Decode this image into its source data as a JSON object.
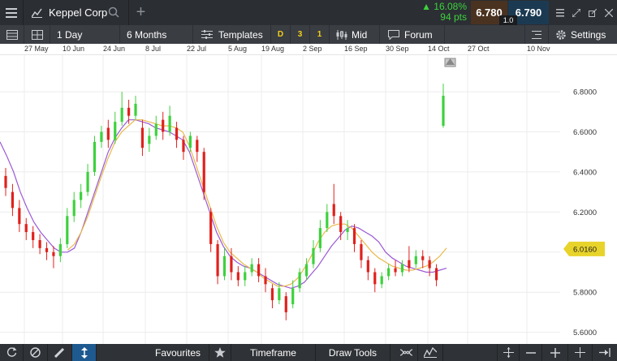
{
  "app": {
    "instrument_name": "Keppel Corp",
    "add_tab_symbol": "+",
    "price_change_pct": "16.08%",
    "price_change_pts": "94 pts",
    "sell_price": "6.780",
    "buy_price": "6.790",
    "spread": "1.0",
    "up_color": "#3dd13d",
    "down_color": "#e0211d"
  },
  "toolbar": {
    "interval": "1 Day",
    "range": "6 Months",
    "templates_label": "Templates",
    "badge_d": "D",
    "badge_3": "3",
    "badge_1": "1",
    "price_type": "Mid",
    "forum_label": "Forum",
    "settings_label": "Settings"
  },
  "bottom": {
    "favourites_label": "Favourites",
    "timeframe_label": "Timeframe",
    "draw_tools_label": "Draw Tools"
  },
  "chart_data": {
    "type": "candlestick",
    "x_tick_labels": [
      "27 May",
      "10 Jun",
      "24 Jun",
      "8 Jul",
      "22 Jul",
      "5 Aug",
      "19 Aug",
      "2 Sep",
      "16 Sep",
      "30 Sep",
      "14 Oct",
      "27 Oct",
      "10 Nov"
    ],
    "y_tick_labels": [
      "6.8000",
      "6.6000",
      "6.4000",
      "6.2000",
      "6.0000",
      "5.8000",
      "5.6000"
    ],
    "ylim": [
      5.55,
      6.95
    ],
    "current_price_label": "6.0160",
    "current_price_color": "#e8d32a",
    "grid": true,
    "moving_averages": [
      {
        "color": "#9b59d6",
        "values": [
          6.55,
          6.48,
          6.4,
          6.3,
          6.22,
          6.15,
          6.1,
          6.06,
          6.02,
          6.0,
          6.0,
          6.02,
          6.1,
          6.2,
          6.3,
          6.4,
          6.5,
          6.57,
          6.62,
          6.66,
          6.66,
          6.65,
          6.64,
          6.62,
          6.61,
          6.6,
          6.58,
          6.56,
          6.5,
          6.4,
          6.3,
          6.2,
          6.1,
          6.03,
          5.98,
          5.95,
          5.93,
          5.92,
          5.9,
          5.88,
          5.86,
          5.84,
          5.83,
          5.82,
          5.83,
          5.85,
          5.89,
          5.93,
          5.98,
          6.03,
          6.07,
          6.11,
          6.13,
          6.12,
          6.1,
          6.08,
          6.05,
          6.0,
          5.97,
          5.95,
          5.93,
          5.92,
          5.91,
          5.9,
          5.9,
          5.91,
          5.92
        ]
      },
      {
        "color": "#e8b94a",
        "values": [
          null,
          null,
          null,
          null,
          null,
          null,
          null,
          null,
          null,
          null,
          6.01,
          6.04,
          6.1,
          6.18,
          6.28,
          6.38,
          6.47,
          6.55,
          6.6,
          6.63,
          6.66,
          6.66,
          6.65,
          6.64,
          6.63,
          6.63,
          6.62,
          6.6,
          6.53,
          6.43,
          6.33,
          6.23,
          6.13,
          6.05,
          6.0,
          5.97,
          5.94,
          5.92,
          5.9,
          5.87,
          5.85,
          5.83,
          5.83,
          5.84,
          5.87,
          5.92,
          5.98,
          6.05,
          6.1,
          6.13,
          6.14,
          6.14,
          6.12,
          6.08,
          6.04,
          6.0,
          5.97,
          5.95,
          5.93,
          5.92,
          5.91,
          5.91,
          5.92,
          5.93,
          5.95,
          5.98,
          6.02
        ]
      }
    ],
    "candles": [
      {
        "o": 6.38,
        "c": 6.32,
        "h": 6.42,
        "l": 6.28
      },
      {
        "o": 6.3,
        "c": 6.22,
        "h": 6.34,
        "l": 6.18
      },
      {
        "o": 6.22,
        "c": 6.14,
        "h": 6.26,
        "l": 6.1
      },
      {
        "o": 6.14,
        "c": 6.1,
        "h": 6.17,
        "l": 6.06
      },
      {
        "o": 6.1,
        "c": 6.06,
        "h": 6.13,
        "l": 6.02
      },
      {
        "o": 6.06,
        "c": 6.02,
        "h": 6.09,
        "l": 5.99
      },
      {
        "o": 6.02,
        "c": 6.0,
        "h": 6.05,
        "l": 5.96
      },
      {
        "o": 6.0,
        "c": 5.98,
        "h": 6.03,
        "l": 5.92
      },
      {
        "o": 5.98,
        "c": 6.04,
        "h": 6.07,
        "l": 5.95
      },
      {
        "o": 6.04,
        "c": 6.18,
        "h": 6.22,
        "l": 6.02
      },
      {
        "o": 6.18,
        "c": 6.26,
        "h": 6.3,
        "l": 6.15
      },
      {
        "o": 6.26,
        "c": 6.3,
        "h": 6.34,
        "l": 6.22
      },
      {
        "o": 6.3,
        "c": 6.4,
        "h": 6.44,
        "l": 6.28
      },
      {
        "o": 6.4,
        "c": 6.55,
        "h": 6.58,
        "l": 6.38
      },
      {
        "o": 6.55,
        "c": 6.6,
        "h": 6.63,
        "l": 6.52
      },
      {
        "o": 6.62,
        "c": 6.56,
        "h": 6.66,
        "l": 6.52
      },
      {
        "o": 6.56,
        "c": 6.65,
        "h": 6.7,
        "l": 6.54
      },
      {
        "o": 6.65,
        "c": 6.72,
        "h": 6.8,
        "l": 6.63
      },
      {
        "o": 6.72,
        "c": 6.68,
        "h": 6.76,
        "l": 6.64
      },
      {
        "o": 6.68,
        "c": 6.74,
        "h": 6.78,
        "l": 6.66
      },
      {
        "o": 6.62,
        "c": 6.52,
        "h": 6.66,
        "l": 6.48
      },
      {
        "o": 6.54,
        "c": 6.58,
        "h": 6.62,
        "l": 6.5
      },
      {
        "o": 6.58,
        "c": 6.64,
        "h": 6.68,
        "l": 6.56
      },
      {
        "o": 6.66,
        "c": 6.6,
        "h": 6.7,
        "l": 6.56
      },
      {
        "o": 6.6,
        "c": 6.68,
        "h": 6.73,
        "l": 6.58
      },
      {
        "o": 6.62,
        "c": 6.56,
        "h": 6.65,
        "l": 6.52
      },
      {
        "o": 6.56,
        "c": 6.5,
        "h": 6.58,
        "l": 6.46
      },
      {
        "o": 6.52,
        "c": 6.58,
        "h": 6.6,
        "l": 6.5
      },
      {
        "o": 6.56,
        "c": 6.5,
        "h": 6.58,
        "l": 6.45
      },
      {
        "o": 6.5,
        "c": 6.3,
        "h": 6.52,
        "l": 6.26
      },
      {
        "o": 6.2,
        "c": 6.04,
        "h": 6.22,
        "l": 6.0
      },
      {
        "o": 6.04,
        "c": 5.88,
        "h": 6.06,
        "l": 5.84
      },
      {
        "o": 5.88,
        "c": 5.98,
        "h": 6.02,
        "l": 5.86
      },
      {
        "o": 5.98,
        "c": 5.9,
        "h": 6.02,
        "l": 5.86
      },
      {
        "o": 5.9,
        "c": 5.86,
        "h": 5.93,
        "l": 5.83
      },
      {
        "o": 5.86,
        "c": 5.9,
        "h": 5.93,
        "l": 5.83
      },
      {
        "o": 5.9,
        "c": 5.94,
        "h": 5.97,
        "l": 5.88
      },
      {
        "o": 5.94,
        "c": 5.88,
        "h": 5.97,
        "l": 5.85
      },
      {
        "o": 5.88,
        "c": 5.84,
        "h": 5.92,
        "l": 5.8
      },
      {
        "o": 5.82,
        "c": 5.76,
        "h": 5.84,
        "l": 5.72
      },
      {
        "o": 5.76,
        "c": 5.82,
        "h": 5.85,
        "l": 5.74
      },
      {
        "o": 5.78,
        "c": 5.7,
        "h": 5.8,
        "l": 5.66
      },
      {
        "o": 5.74,
        "c": 5.82,
        "h": 5.86,
        "l": 5.72
      },
      {
        "o": 5.82,
        "c": 5.9,
        "h": 5.92,
        "l": 5.8
      },
      {
        "o": 5.88,
        "c": 5.94,
        "h": 5.97,
        "l": 5.86
      },
      {
        "o": 5.94,
        "c": 6.02,
        "h": 6.06,
        "l": 5.92
      },
      {
        "o": 6.02,
        "c": 6.12,
        "h": 6.16,
        "l": 6.0
      },
      {
        "o": 6.12,
        "c": 6.2,
        "h": 6.24,
        "l": 6.1
      },
      {
        "o": 6.24,
        "c": 6.18,
        "h": 6.34,
        "l": 6.14
      },
      {
        "o": 6.18,
        "c": 6.1,
        "h": 6.2,
        "l": 6.06
      },
      {
        "o": 6.1,
        "c": 6.12,
        "h": 6.16,
        "l": 6.06
      },
      {
        "o": 6.12,
        "c": 6.04,
        "h": 6.14,
        "l": 6.0
      },
      {
        "o": 6.04,
        "c": 5.96,
        "h": 6.06,
        "l": 5.92
      },
      {
        "o": 5.96,
        "c": 5.9,
        "h": 5.98,
        "l": 5.86
      },
      {
        "o": 5.9,
        "c": 5.84,
        "h": 5.92,
        "l": 5.8
      },
      {
        "o": 5.84,
        "c": 5.88,
        "h": 5.9,
        "l": 5.82
      },
      {
        "o": 5.88,
        "c": 5.92,
        "h": 5.94,
        "l": 5.86
      },
      {
        "o": 5.92,
        "c": 5.9,
        "h": 5.96,
        "l": 5.88
      },
      {
        "o": 5.9,
        "c": 5.94,
        "h": 5.96,
        "l": 5.88
      },
      {
        "o": 5.96,
        "c": 5.92,
        "h": 6.03,
        "l": 5.9
      },
      {
        "o": 5.94,
        "c": 5.98,
        "h": 6.01,
        "l": 5.92
      },
      {
        "o": 5.98,
        "c": 5.96,
        "h": 6.01,
        "l": 5.92
      },
      {
        "o": 5.96,
        "c": 5.92,
        "h": 5.98,
        "l": 5.88
      },
      {
        "o": 5.92,
        "c": 5.86,
        "h": 5.94,
        "l": 5.83
      },
      {
        "o": 6.63,
        "c": 6.78,
        "h": 6.84,
        "l": 6.62
      }
    ]
  }
}
